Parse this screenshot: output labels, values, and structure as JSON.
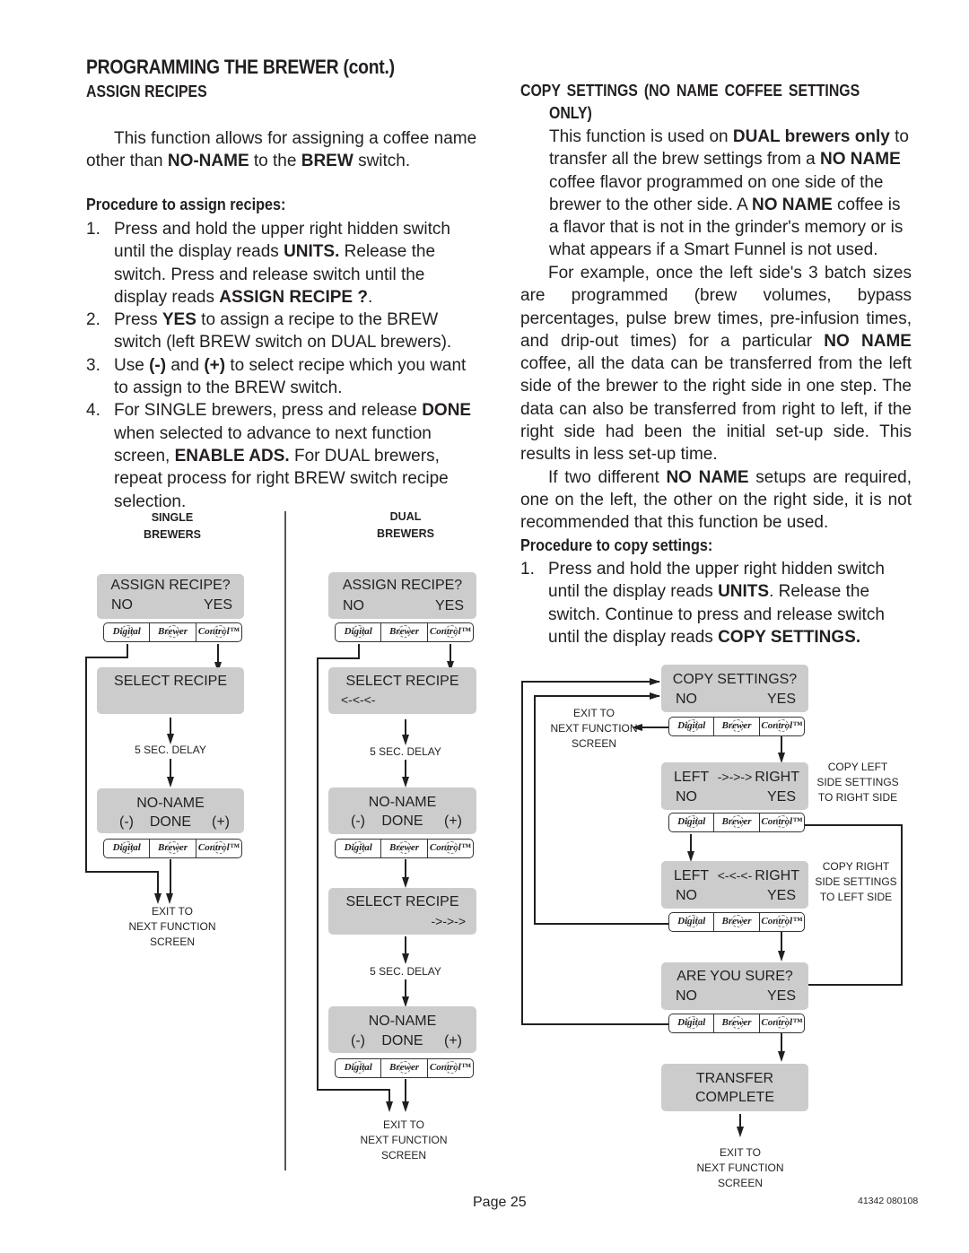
{
  "page_title": "PROGRAMMING THE BREWER (cont.)",
  "left": {
    "section_title": "ASSIGN RECIPES",
    "intro": [
      "This function allows for assigning a coffee name other than ",
      "NO-NAME",
      " to the ",
      "BREW",
      " switch."
    ],
    "procedure_title": "Procedure to assign recipes:",
    "steps": [
      {
        "num": "1.",
        "parts": [
          "Press and hold the upper right hidden switch until the display reads ",
          "UNITS.",
          " Release the switch. Press and release switch until the display reads ",
          "ASSIGN RECIPE ?",
          "."
        ]
      },
      {
        "num": "2.",
        "parts": [
          "Press ",
          "YES",
          " to assign a recipe to the BREW switch (left BREW switch on DUAL brewers).",
          "",
          ""
        ]
      },
      {
        "num": "3.",
        "parts": [
          "Use ",
          "(-)",
          " and ",
          "(+)",
          " to select recipe which you want to assign to the BREW switch."
        ]
      },
      {
        "num": "4.",
        "parts": [
          "For SINGLE brewers, press and release ",
          "DONE",
          " when selected to advance to next function screen, ",
          "ENABLE ADS.",
          " For DUAL brewers, repeat process for right BREW switch recipe selection."
        ]
      }
    ]
  },
  "diagram_single": {
    "caption": [
      "SINGLE",
      "BREWERS"
    ],
    "screens": [
      {
        "line1": "ASSIGN  RECIPE?",
        "line2_left": "NO",
        "line2_right": "YES"
      },
      {
        "line1": "SELECT  RECIPE",
        "line2": ""
      },
      {
        "line1": "NO-NAME",
        "line2_left": "(-)",
        "line2_center": "DONE",
        "line2_right": "(+)"
      }
    ],
    "delay_label": "5 SEC. DELAY",
    "exit_label": [
      "EXIT TO",
      "NEXT FUNCTION",
      "SCREEN"
    ]
  },
  "diagram_dual": {
    "caption": [
      "DUAL",
      "BREWERS"
    ],
    "screens": [
      {
        "line1": "ASSIGN  RECIPE?",
        "line2_left": "NO",
        "line2_right": "YES"
      },
      {
        "line1": "SELECT  RECIPE",
        "line2": "<-<-<-"
      },
      {
        "line1": "NO-NAME",
        "line2_left": "(-)",
        "line2_center": "DONE",
        "line2_right": "(+)"
      },
      {
        "line1": "SELECT  RECIPE",
        "line2": "->->->"
      },
      {
        "line1": "NO-NAME",
        "line2_left": "(-)",
        "line2_center": "DONE",
        "line2_right": "(+)"
      }
    ],
    "delay_label": "5 SEC. DELAY",
    "exit_label": [
      "EXIT TO",
      "NEXT FUNCTION",
      "SCREEN"
    ]
  },
  "keypad": {
    "keys": [
      "Digital",
      "Brewer",
      "Control™"
    ]
  },
  "right": {
    "section_title_line1": "COPY  SETTINGS  (NO  NAME  COFFEE  SETTINGS",
    "section_title_line2": "ONLY)",
    "para1": [
      "This function is used on ",
      "DUAL brewers only",
      " to transfer all the brew settings from a ",
      "NO NAME",
      " coffee flavor programmed on one side of the brewer to the other side. A ",
      "NO NAME",
      " coffee is a flavor that is not in the grinder's memory or is what appears if a Smart Funnel is not used."
    ],
    "para2": [
      "For example, once the left side's 3 batch sizes are programmed (brew volumes, bypass percentages, pulse brew times, pre-infusion times, and drip-out times) for a particular ",
      "NO NAME",
      " coffee, all the data can be transferred from the left side of the brewer to the right side in one step.  The data can also be transferred from right to left, if the right side had been the initial set-up side.  This results in less set-up time."
    ],
    "para3": [
      "If two different ",
      "NO NAME",
      " setups are required, one on the left, the other on the right side, it is not recommended that this function be used."
    ],
    "procedure_title": "Procedure to copy settings:",
    "steps": [
      {
        "num": "1.",
        "parts": [
          "Press and hold the upper right hidden switch until the display reads ",
          "UNITS",
          ". Release the switch.  Continue to press and release switch until the display reads ",
          "COPY SETTINGS.",
          ""
        ]
      }
    ]
  },
  "diagram_copy": {
    "screens": [
      {
        "line1": "COPY SETTINGS?",
        "line2_left": "NO",
        "line2_right": "YES"
      },
      {
        "line1_left": "LEFT",
        "line1_center": "->->->",
        "line1_right": "RIGHT",
        "line2_left": "NO",
        "line2_right": "YES"
      },
      {
        "line1_left": "LEFT",
        "line1_center": "<-<-<-",
        "line1_right": "RIGHT",
        "line2_left": "NO",
        "line2_right": "YES"
      },
      {
        "line1": "ARE YOU SURE?",
        "line2_left": "NO",
        "line2_right": "YES"
      },
      {
        "line1": "TRANSFER",
        "line2": "COMPLETE"
      }
    ],
    "note_left_to_right": [
      "COPY LEFT",
      "SIDE SETTINGS",
      "TO RIGHT SIDE"
    ],
    "note_right_to_left": [
      "COPY RIGHT",
      "SIDE SETTINGS",
      "TO LEFT SIDE"
    ],
    "exit_label_top": [
      "EXIT TO",
      "NEXT FUNCTION",
      "SCREEN"
    ],
    "exit_label_bottom": [
      "EXIT TO",
      "NEXT FUNCTION",
      "SCREEN"
    ]
  },
  "footer": {
    "page": "Page 25",
    "doc_code": "41342 080108"
  },
  "colors": {
    "lcd": "#cccccd",
    "text": "#231f20",
    "line": "#231f20"
  }
}
